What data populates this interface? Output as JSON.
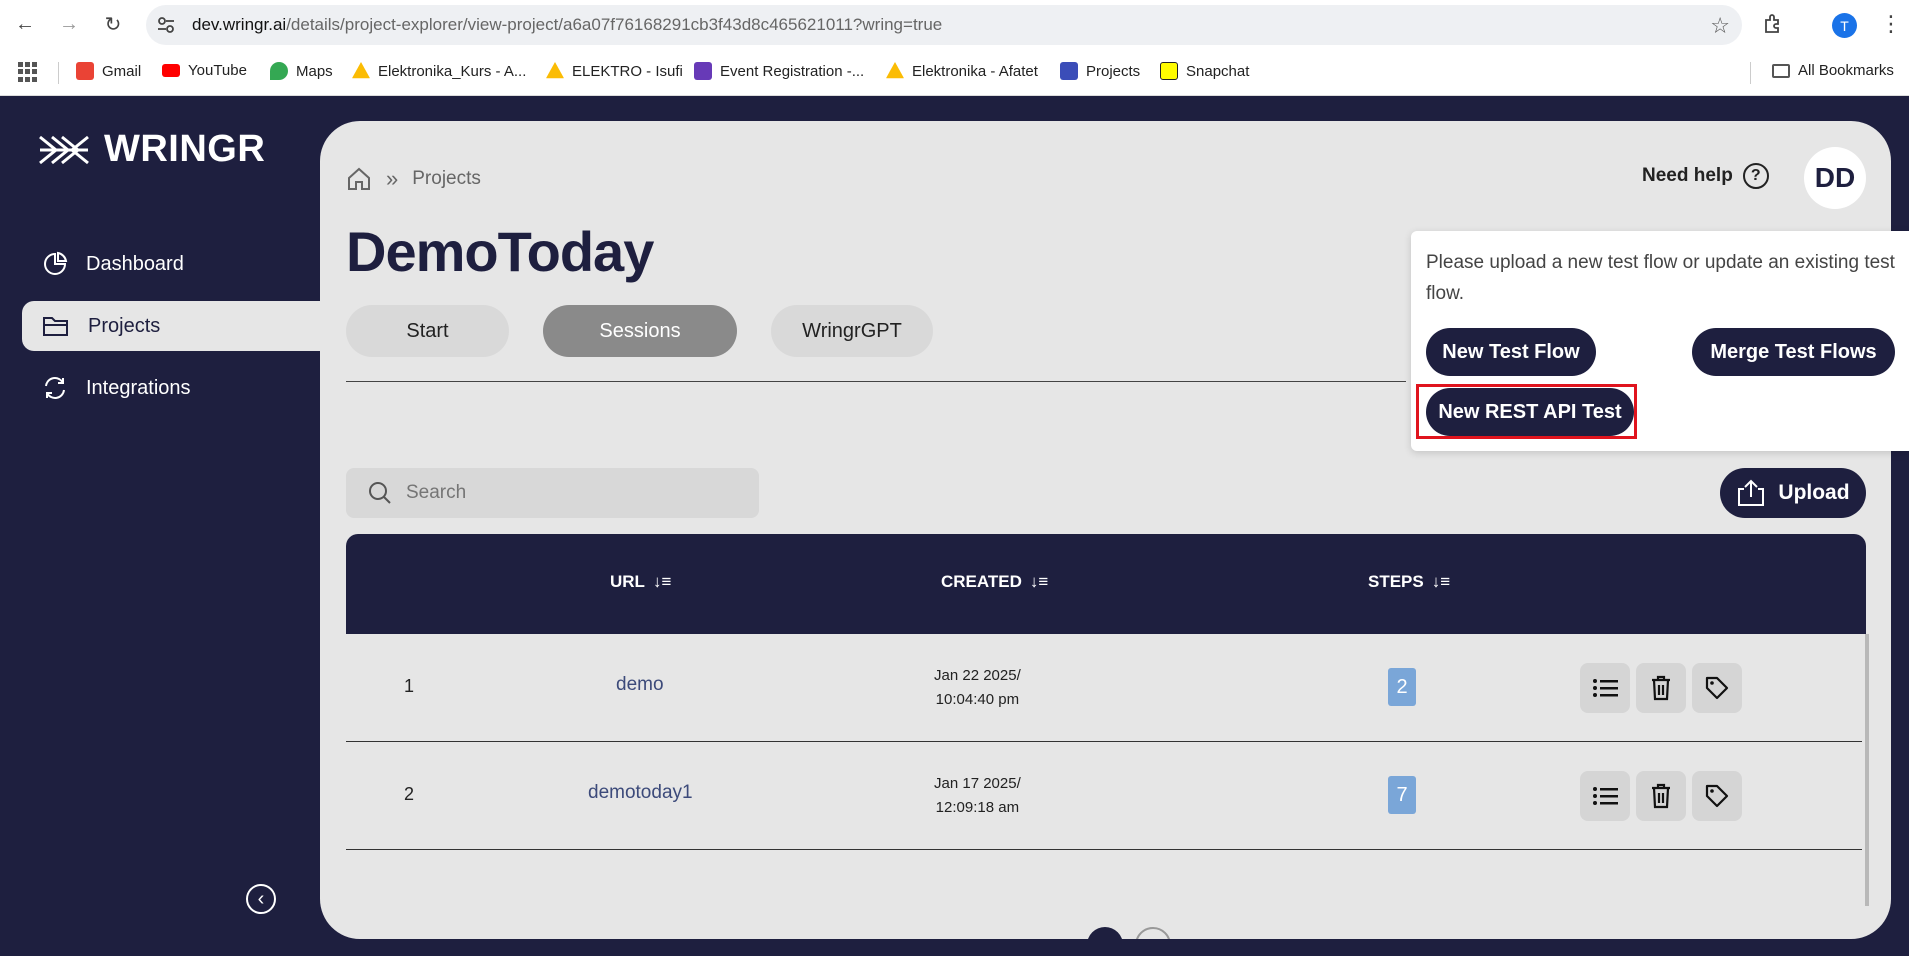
{
  "browser": {
    "url_host": "dev.wringr.ai",
    "url_path": "/details/project-explorer/view-project/a6a07f76168291cb3f43d8c465621011?wring=true",
    "profile_initial": "T",
    "bookmarks": [
      {
        "label": "Gmail",
        "icon": "gmail-icon",
        "color": "#ea4335"
      },
      {
        "label": "YouTube",
        "icon": "youtube-icon",
        "color": "#ff0000"
      },
      {
        "label": "Maps",
        "icon": "maps-icon",
        "color": "#34a853"
      },
      {
        "label": "Elektronika_Kurs - A...",
        "icon": "drive-icon",
        "color": "#fbbc04"
      },
      {
        "label": "ELEKTRO - Isufi",
        "icon": "drive-icon",
        "color": "#fbbc04"
      },
      {
        "label": "Event Registration -...",
        "icon": "forms-icon",
        "color": "#673ab7"
      },
      {
        "label": "Elektronika - Afatet",
        "icon": "drive-icon",
        "color": "#fbbc04"
      },
      {
        "label": "Projects",
        "icon": "wringr-icon",
        "color": "#3b4db8"
      },
      {
        "label": "Snapchat",
        "icon": "snapchat-icon",
        "color": "#fffc00"
      }
    ],
    "all_bookmarks": "All Bookmarks"
  },
  "sidebar": {
    "logo": "WRINGR",
    "items": [
      {
        "label": "Dashboard",
        "icon": "pie-chart-icon"
      },
      {
        "label": "Projects",
        "icon": "folder-icon"
      },
      {
        "label": "Integrations",
        "icon": "sync-icon"
      }
    ]
  },
  "header": {
    "breadcrumb_current": "Projects",
    "help": "Need help",
    "avatar": "DD",
    "title": "DemoToday"
  },
  "tabs": [
    "Start",
    "Sessions",
    "WringrGPT"
  ],
  "search": {
    "placeholder": "Search"
  },
  "upload_label": "Upload",
  "table": {
    "columns": [
      "URL",
      "CREATED",
      "STEPS"
    ],
    "rows": [
      {
        "index": "1",
        "url": "demo",
        "date_line1": "Jan 22 2025/",
        "date_line2": "10:04:40 pm",
        "steps": "2"
      },
      {
        "index": "2",
        "url": "demotoday1",
        "date_line1": "Jan 17 2025/",
        "date_line2": "12:09:18 am",
        "steps": "7"
      }
    ]
  },
  "popup": {
    "message": "Please upload a new test flow or update an existing test flow.",
    "new_test_flow": "New Test Flow",
    "merge_test_flows": "Merge Test Flows",
    "new_rest_api_test": "New REST API Test"
  }
}
